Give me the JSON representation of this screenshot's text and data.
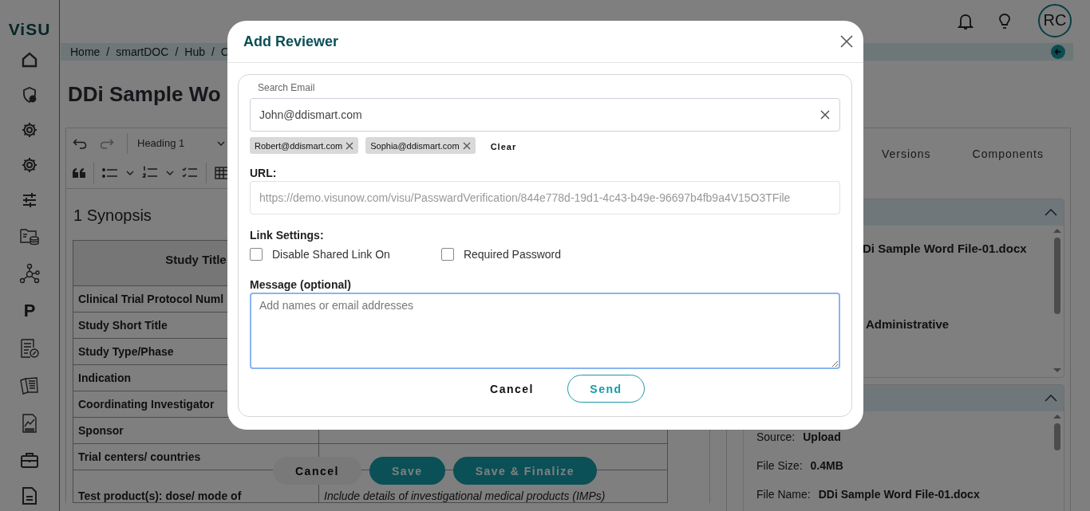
{
  "sidebar": {
    "logo": "ViSU",
    "letter_item": "P"
  },
  "header": {
    "avatar": "RC"
  },
  "breadcrumb": {
    "separator": "/",
    "items": [
      "Home",
      "smartDOC",
      "Hub",
      "C"
    ]
  },
  "page_title": "DDi Sample Wo",
  "editor": {
    "style_select": "Heading 1",
    "heading": "1 Synopsis",
    "table": {
      "header": "Study Title",
      "rows": [
        "Clinical Trial Protocol Numl",
        "Study Short Title",
        "Study Type/Phase",
        "Indication",
        "Coordinating Investigator",
        "Sponsor",
        "Trial centers/ countries"
      ],
      "last_row": {
        "label": "Test product(s): dose/ mode of",
        "value": "Include details of investigational medical products (IMPs)"
      }
    },
    "buttons": [
      {
        "label": "Cancel",
        "kind": "plain"
      },
      {
        "label": "Save",
        "kind": "primary"
      },
      {
        "label": "Save & Finalize",
        "kind": "primary"
      }
    ]
  },
  "details_panel": {
    "tabs": [
      {
        "label": "Versions",
        "selected": false
      },
      {
        "label": "Components",
        "selected": false
      }
    ],
    "sections": [
      {
        "expanded": true,
        "fields": [
          {
            "value": "Di Sample Word File-01.docx"
          },
          {
            "value": "Administrative"
          }
        ]
      },
      {
        "expanded": true,
        "fields": [
          {
            "label": "Source:",
            "value": "Upload"
          },
          {
            "label": "File Size:",
            "value": "0.4MB"
          },
          {
            "label": "File Name:",
            "value": "DDi Sample Word File-01.docx"
          }
        ]
      }
    ]
  },
  "modal": {
    "title": "Add Reviewer",
    "search_label": "Search Email",
    "search_value": "John@ddismart.com",
    "chips": [
      "Robert@ddismart.com",
      "Sophia@ddismart.com"
    ],
    "clear": "Clear",
    "url_label": "URL:",
    "url_value": "https://demo.visunow.com/visu/PasswardVerification/844e778d-19d1-4c43-b49e-96697b4fb9a4V15O3TFile",
    "link_settings_label": "Link Settings:",
    "options": [
      {
        "label": "Disable Shared Link On",
        "checked": false
      },
      {
        "label": "Required Password",
        "checked": false
      }
    ],
    "message_label": "Message (optional)",
    "message_placeholder": "Add names or email addresses",
    "buttons": [
      {
        "label": "Cancel",
        "kind": "plain"
      },
      {
        "label": "Send",
        "kind": "outline"
      }
    ]
  }
}
